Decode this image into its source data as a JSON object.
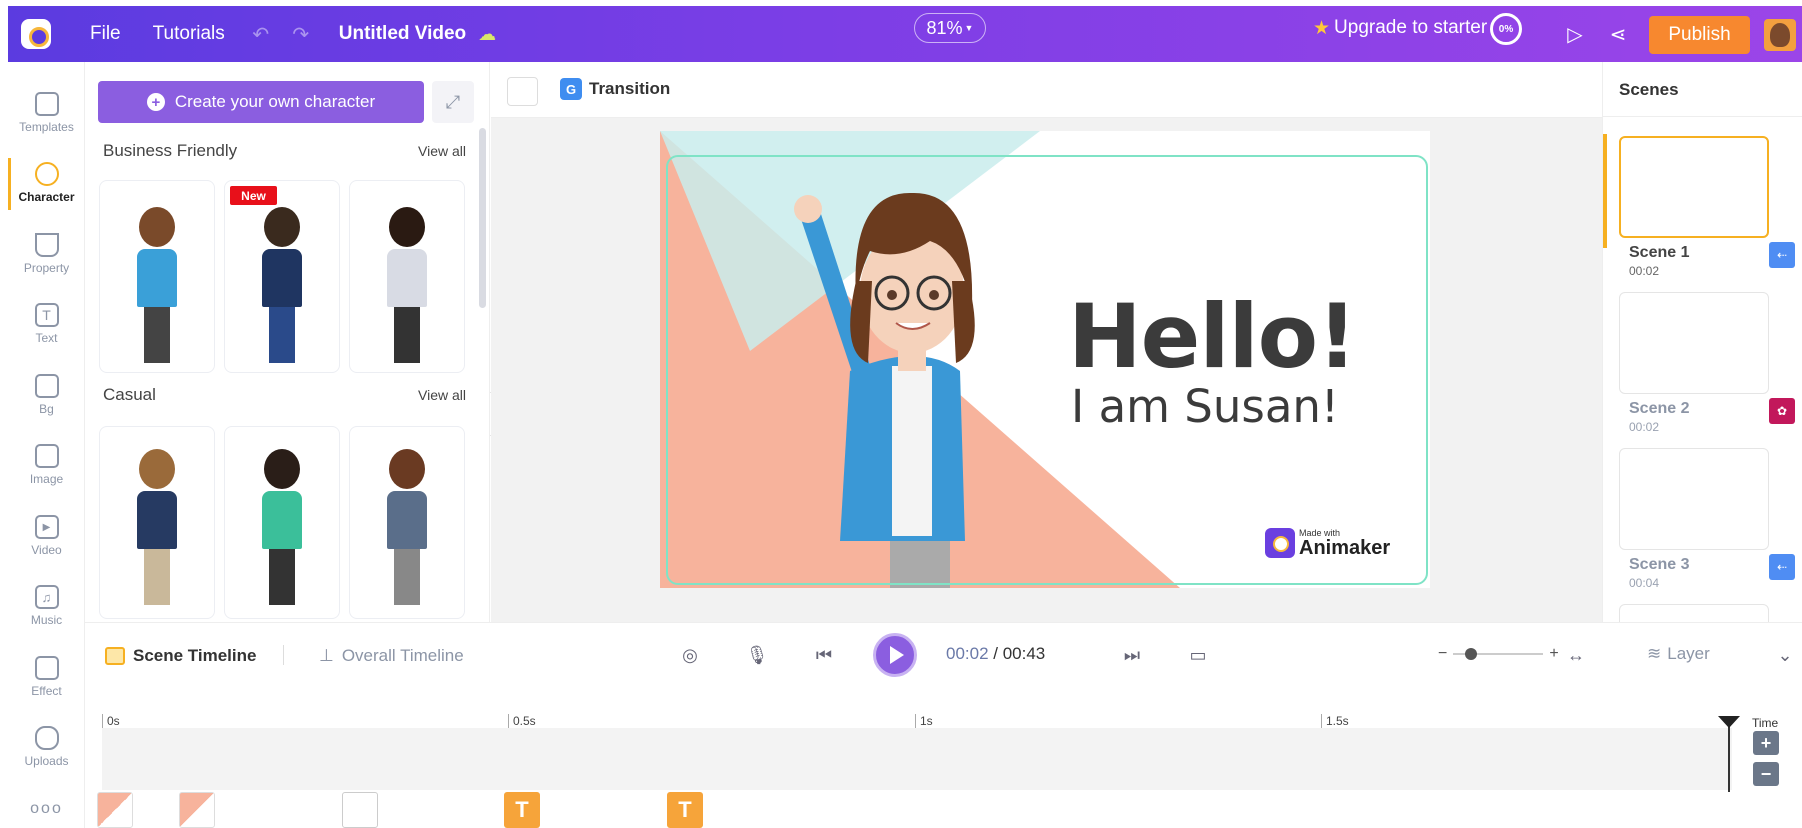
{
  "topbar": {
    "file": "File",
    "tutorials": "Tutorials",
    "project_title": "Untitled Video",
    "zoom": "81%",
    "upgrade": "Upgrade to starter",
    "progress": "0%",
    "publish": "Publish"
  },
  "sidebar": {
    "items": [
      {
        "label": "Templates"
      },
      {
        "label": "Character"
      },
      {
        "label": "Property"
      },
      {
        "label": "Text"
      },
      {
        "label": "Bg"
      },
      {
        "label": "Image"
      },
      {
        "label": "Video"
      },
      {
        "label": "Music"
      },
      {
        "label": "Effect"
      },
      {
        "label": "Uploads"
      }
    ],
    "more": "ooo"
  },
  "panel": {
    "create_button": "Create your own character",
    "sections": [
      {
        "title": "Business Friendly",
        "view_all": "View all"
      },
      {
        "title": "Casual",
        "view_all": "View all"
      }
    ],
    "new_badge": "New"
  },
  "stage": {
    "transition": "Transition",
    "hello": "Hello!",
    "subtitle": "I am Susan!",
    "made_with": "Made with",
    "brand": "Animaker"
  },
  "scenes": {
    "title": "Scenes",
    "items": [
      {
        "name": "Scene 1",
        "time": "00:02"
      },
      {
        "name": "Scene 2",
        "time": "00:02"
      },
      {
        "name": "Scene 3",
        "time": "00:04"
      }
    ]
  },
  "timeline": {
    "scene_tab": "Scene Timeline",
    "overall_tab": "Overall Timeline",
    "current_time": "00:02",
    "separator": " / ",
    "total_time": "00:43",
    "layer": "Layer",
    "ruler": [
      "0s",
      "0.5s",
      "1s",
      "1.5s"
    ],
    "time_label": "Time",
    "clip_T": "T"
  },
  "colors": {
    "accent": "#8b5ee0",
    "publish": "#f7882f",
    "active": "#f6b021",
    "bg_shape": "#f7b39c"
  }
}
